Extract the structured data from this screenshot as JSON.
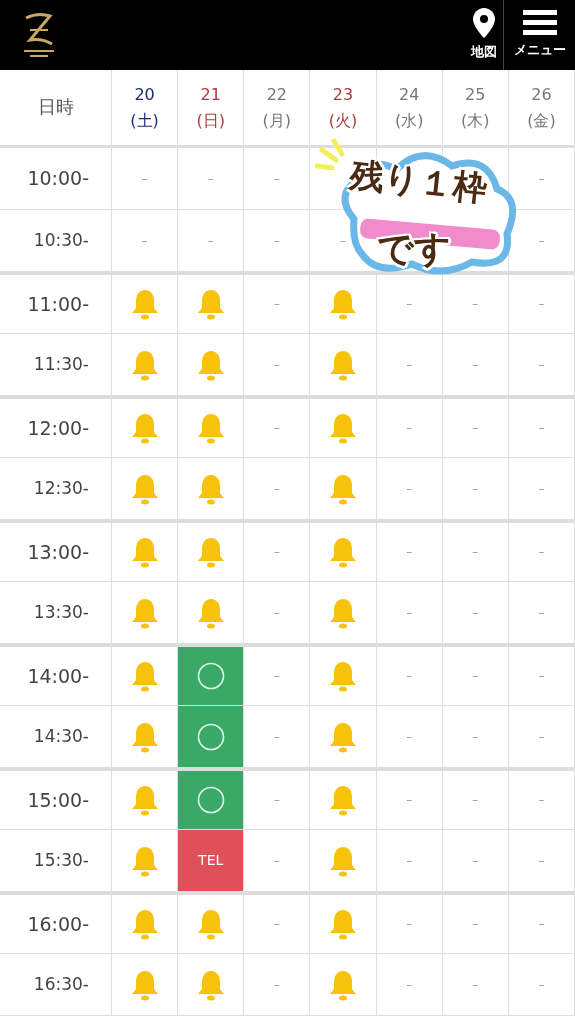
{
  "header": {
    "map_label": "地図",
    "menu_label": "メニュー"
  },
  "table": {
    "corner": "日時",
    "days": [
      {
        "date": "20",
        "weekday": "(土)",
        "kind": "saturday"
      },
      {
        "date": "21",
        "weekday": "(日)",
        "kind": "holiday"
      },
      {
        "date": "22",
        "weekday": "(月)",
        "kind": "weekday"
      },
      {
        "date": "23",
        "weekday": "(火)",
        "kind": "holiday"
      },
      {
        "date": "24",
        "weekday": "(水)",
        "kind": "weekday"
      },
      {
        "date": "25",
        "weekday": "(木)",
        "kind": "weekday"
      },
      {
        "date": "26",
        "weekday": "(金)",
        "kind": "weekday"
      }
    ],
    "rows": [
      {
        "time": "10:00-",
        "cells": [
          {
            "kind": "none",
            "text": "–"
          },
          {
            "kind": "none",
            "text": "–"
          },
          {
            "kind": "none",
            "text": "–"
          },
          {
            "kind": "covered"
          },
          {
            "kind": "covered"
          },
          {
            "kind": "covered"
          },
          {
            "kind": "none",
            "text": "–"
          }
        ]
      },
      {
        "time": "10:30-",
        "cells": [
          {
            "kind": "none",
            "text": "–"
          },
          {
            "kind": "none",
            "text": "–"
          },
          {
            "kind": "none",
            "text": "–"
          },
          {
            "kind": "none",
            "text": "–"
          },
          {
            "kind": "covered"
          },
          {
            "kind": "covered"
          },
          {
            "kind": "none",
            "text": "–"
          }
        ]
      },
      {
        "time": "11:00-",
        "cells": [
          {
            "kind": "bell"
          },
          {
            "kind": "bell"
          },
          {
            "kind": "none",
            "text": "–"
          },
          {
            "kind": "bell"
          },
          {
            "kind": "none",
            "text": "–"
          },
          {
            "kind": "none",
            "text": "–"
          },
          {
            "kind": "none",
            "text": "–"
          }
        ]
      },
      {
        "time": "11:30-",
        "cells": [
          {
            "kind": "bell"
          },
          {
            "kind": "bell"
          },
          {
            "kind": "none",
            "text": "–"
          },
          {
            "kind": "bell"
          },
          {
            "kind": "none",
            "text": "–"
          },
          {
            "kind": "none",
            "text": "–"
          },
          {
            "kind": "none",
            "text": "–"
          }
        ]
      },
      {
        "time": "12:00-",
        "cells": [
          {
            "kind": "bell"
          },
          {
            "kind": "bell"
          },
          {
            "kind": "none",
            "text": "–"
          },
          {
            "kind": "bell"
          },
          {
            "kind": "none",
            "text": "–"
          },
          {
            "kind": "none",
            "text": "–"
          },
          {
            "kind": "none",
            "text": "–"
          }
        ]
      },
      {
        "time": "12:30-",
        "cells": [
          {
            "kind": "bell"
          },
          {
            "kind": "bell"
          },
          {
            "kind": "none",
            "text": "–"
          },
          {
            "kind": "bell"
          },
          {
            "kind": "none",
            "text": "–"
          },
          {
            "kind": "none",
            "text": "–"
          },
          {
            "kind": "none",
            "text": "–"
          }
        ]
      },
      {
        "time": "13:00-",
        "cells": [
          {
            "kind": "bell"
          },
          {
            "kind": "bell"
          },
          {
            "kind": "none",
            "text": "–"
          },
          {
            "kind": "bell"
          },
          {
            "kind": "none",
            "text": "–"
          },
          {
            "kind": "none",
            "text": "–"
          },
          {
            "kind": "none",
            "text": "–"
          }
        ]
      },
      {
        "time": "13:30-",
        "cells": [
          {
            "kind": "bell"
          },
          {
            "kind": "bell"
          },
          {
            "kind": "none",
            "text": "–"
          },
          {
            "kind": "bell"
          },
          {
            "kind": "none",
            "text": "–"
          },
          {
            "kind": "none",
            "text": "–"
          },
          {
            "kind": "none",
            "text": "–"
          }
        ]
      },
      {
        "time": "14:00-",
        "cells": [
          {
            "kind": "bell"
          },
          {
            "kind": "open"
          },
          {
            "kind": "none",
            "text": "–"
          },
          {
            "kind": "bell"
          },
          {
            "kind": "none",
            "text": "–"
          },
          {
            "kind": "none",
            "text": "–"
          },
          {
            "kind": "none",
            "text": "–"
          }
        ]
      },
      {
        "time": "14:30-",
        "cells": [
          {
            "kind": "bell"
          },
          {
            "kind": "open"
          },
          {
            "kind": "none",
            "text": "–"
          },
          {
            "kind": "bell"
          },
          {
            "kind": "none",
            "text": "–"
          },
          {
            "kind": "none",
            "text": "–"
          },
          {
            "kind": "none",
            "text": "–"
          }
        ]
      },
      {
        "time": "15:00-",
        "cells": [
          {
            "kind": "bell"
          },
          {
            "kind": "open"
          },
          {
            "kind": "none",
            "text": "–"
          },
          {
            "kind": "bell"
          },
          {
            "kind": "none",
            "text": "–"
          },
          {
            "kind": "none",
            "text": "–"
          },
          {
            "kind": "none",
            "text": "–"
          }
        ]
      },
      {
        "time": "15:30-",
        "cells": [
          {
            "kind": "bell"
          },
          {
            "kind": "tel",
            "text": "TEL"
          },
          {
            "kind": "none",
            "text": "–"
          },
          {
            "kind": "bell"
          },
          {
            "kind": "none",
            "text": "–"
          },
          {
            "kind": "none",
            "text": "–"
          },
          {
            "kind": "none",
            "text": "–"
          }
        ]
      },
      {
        "time": "16:00-",
        "cells": [
          {
            "kind": "bell"
          },
          {
            "kind": "bell"
          },
          {
            "kind": "none",
            "text": "–"
          },
          {
            "kind": "bell"
          },
          {
            "kind": "none",
            "text": "–"
          },
          {
            "kind": "none",
            "text": "–"
          },
          {
            "kind": "none",
            "text": "–"
          }
        ]
      },
      {
        "time": "16:30-",
        "cells": [
          {
            "kind": "bell"
          },
          {
            "kind": "bell"
          },
          {
            "kind": "none",
            "text": "–"
          },
          {
            "kind": "bell"
          },
          {
            "kind": "none",
            "text": "–"
          },
          {
            "kind": "none",
            "text": "–"
          },
          {
            "kind": "none",
            "text": "–"
          }
        ]
      }
    ]
  },
  "sticker": {
    "line_1": "残り１枠",
    "line_2": "です"
  }
}
